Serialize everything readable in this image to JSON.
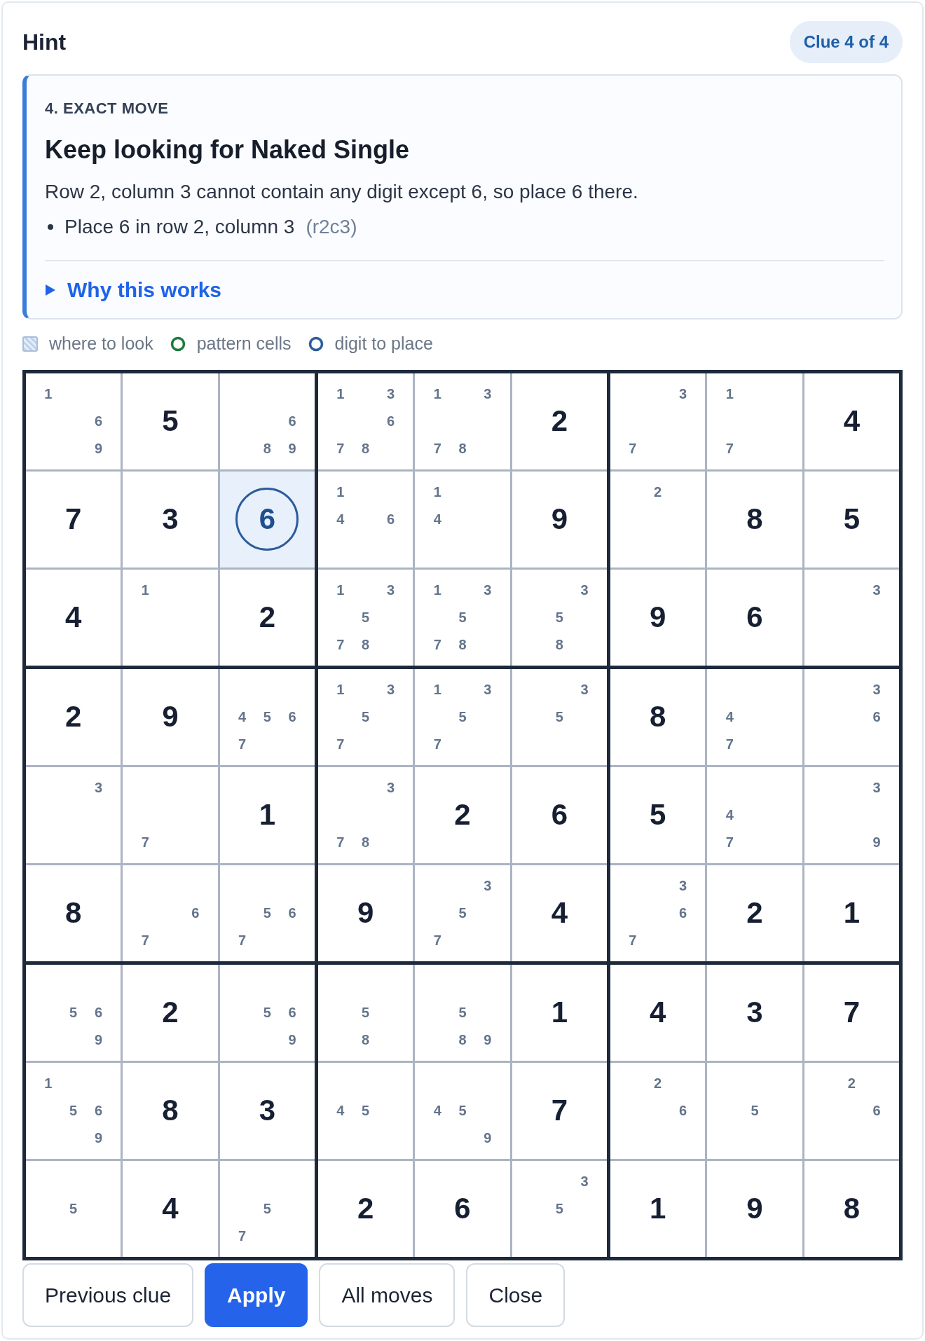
{
  "title": "Hint",
  "badge": "Clue 4 of 4",
  "hint": {
    "step": "4. EXACT MOVE",
    "heading": "Keep looking for Naked Single",
    "text": "Row 2, column 3 cannot contain any digit except 6, so place 6 there.",
    "bullets": [
      {
        "text": "Place 6 in row 2, column 3",
        "ref": "(r2c3)"
      }
    ],
    "details": {
      "label": "Why this works",
      "expanded": false
    }
  },
  "legend": [
    {
      "kind": "hatch",
      "label": "where to look"
    },
    {
      "kind": "ring",
      "label": "pattern cells",
      "color": "#1e7a3c"
    },
    {
      "kind": "ring",
      "label": "digit to place",
      "color": "#2c5c9c"
    }
  ],
  "grid": [
    [
      {
        "kind": "candidates",
        "candidates": [
          "1",
          "6",
          "9"
        ]
      },
      {
        "kind": "given",
        "value": "5"
      },
      {
        "kind": "candidates",
        "candidates": [
          "6",
          "8",
          "9"
        ]
      },
      {
        "kind": "candidates",
        "candidates": [
          "1",
          "3",
          "6",
          "7",
          "8"
        ]
      },
      {
        "kind": "candidates",
        "candidates": [
          "1",
          "3",
          "7",
          "8"
        ]
      },
      {
        "kind": "given",
        "value": "2"
      },
      {
        "kind": "candidates",
        "candidates": [
          "3",
          "7"
        ]
      },
      {
        "kind": "candidates",
        "candidates": [
          "1",
          "7"
        ]
      },
      {
        "kind": "given",
        "value": "4"
      }
    ],
    [
      {
        "kind": "given",
        "value": "7"
      },
      {
        "kind": "given",
        "value": "3"
      },
      {
        "kind": "place",
        "value": "6"
      },
      {
        "kind": "candidates",
        "candidates": [
          "1",
          "4",
          "6"
        ]
      },
      {
        "kind": "candidates",
        "candidates": [
          "1",
          "4"
        ]
      },
      {
        "kind": "given",
        "value": "9"
      },
      {
        "kind": "candidates",
        "candidates": [
          "2"
        ]
      },
      {
        "kind": "given",
        "value": "8"
      },
      {
        "kind": "given",
        "value": "5"
      }
    ],
    [
      {
        "kind": "given",
        "value": "4"
      },
      {
        "kind": "candidates",
        "candidates": [
          "1"
        ]
      },
      {
        "kind": "given",
        "value": "2"
      },
      {
        "kind": "candidates",
        "candidates": [
          "1",
          "3",
          "5",
          "7",
          "8"
        ]
      },
      {
        "kind": "candidates",
        "candidates": [
          "1",
          "3",
          "5",
          "7",
          "8"
        ]
      },
      {
        "kind": "candidates",
        "candidates": [
          "3",
          "5",
          "8"
        ]
      },
      {
        "kind": "given",
        "value": "9"
      },
      {
        "kind": "given",
        "value": "6"
      },
      {
        "kind": "candidates",
        "candidates": [
          "3"
        ]
      }
    ],
    [
      {
        "kind": "given",
        "value": "2"
      },
      {
        "kind": "given",
        "value": "9"
      },
      {
        "kind": "candidates",
        "candidates": [
          "4",
          "5",
          "6",
          "7"
        ]
      },
      {
        "kind": "candidates",
        "candidates": [
          "1",
          "3",
          "5",
          "7"
        ]
      },
      {
        "kind": "candidates",
        "candidates": [
          "1",
          "3",
          "5",
          "7"
        ]
      },
      {
        "kind": "candidates",
        "candidates": [
          "3",
          "5"
        ]
      },
      {
        "kind": "given",
        "value": "8"
      },
      {
        "kind": "candidates",
        "candidates": [
          "4",
          "7"
        ]
      },
      {
        "kind": "candidates",
        "candidates": [
          "3",
          "6"
        ]
      }
    ],
    [
      {
        "kind": "candidates",
        "candidates": [
          "3"
        ]
      },
      {
        "kind": "candidates",
        "candidates": [
          "7"
        ]
      },
      {
        "kind": "given",
        "value": "1"
      },
      {
        "kind": "candidates",
        "candidates": [
          "3",
          "7",
          "8"
        ]
      },
      {
        "kind": "given",
        "value": "2"
      },
      {
        "kind": "given",
        "value": "6"
      },
      {
        "kind": "given",
        "value": "5"
      },
      {
        "kind": "candidates",
        "candidates": [
          "4",
          "7"
        ]
      },
      {
        "kind": "candidates",
        "candidates": [
          "3",
          "9"
        ]
      }
    ],
    [
      {
        "kind": "given",
        "value": "8"
      },
      {
        "kind": "candidates",
        "candidates": [
          "6",
          "7"
        ]
      },
      {
        "kind": "candidates",
        "candidates": [
          "5",
          "6",
          "7"
        ]
      },
      {
        "kind": "given",
        "value": "9"
      },
      {
        "kind": "candidates",
        "candidates": [
          "3",
          "5",
          "7"
        ]
      },
      {
        "kind": "given",
        "value": "4"
      },
      {
        "kind": "candidates",
        "candidates": [
          "3",
          "6",
          "7"
        ]
      },
      {
        "kind": "given",
        "value": "2"
      },
      {
        "kind": "given",
        "value": "1"
      }
    ],
    [
      {
        "kind": "candidates",
        "candidates": [
          "5",
          "6",
          "9"
        ]
      },
      {
        "kind": "given",
        "value": "2"
      },
      {
        "kind": "candidates",
        "candidates": [
          "5",
          "6",
          "9"
        ]
      },
      {
        "kind": "candidates",
        "candidates": [
          "5",
          "8"
        ]
      },
      {
        "kind": "candidates",
        "candidates": [
          "5",
          "8",
          "9"
        ]
      },
      {
        "kind": "given",
        "value": "1"
      },
      {
        "kind": "given",
        "value": "4"
      },
      {
        "kind": "given",
        "value": "3"
      },
      {
        "kind": "given",
        "value": "7"
      }
    ],
    [
      {
        "kind": "candidates",
        "candidates": [
          "1",
          "5",
          "6",
          "9"
        ]
      },
      {
        "kind": "given",
        "value": "8"
      },
      {
        "kind": "given",
        "value": "3"
      },
      {
        "kind": "candidates",
        "candidates": [
          "4",
          "5"
        ]
      },
      {
        "kind": "candidates",
        "candidates": [
          "4",
          "5",
          "9"
        ]
      },
      {
        "kind": "given",
        "value": "7"
      },
      {
        "kind": "candidates",
        "candidates": [
          "2",
          "6"
        ]
      },
      {
        "kind": "candidates",
        "candidates": [
          "5"
        ]
      },
      {
        "kind": "candidates",
        "candidates": [
          "2",
          "6"
        ]
      }
    ],
    [
      {
        "kind": "candidates",
        "candidates": [
          "5"
        ]
      },
      {
        "kind": "given",
        "value": "4"
      },
      {
        "kind": "candidates",
        "candidates": [
          "5",
          "7"
        ]
      },
      {
        "kind": "given",
        "value": "2"
      },
      {
        "kind": "given",
        "value": "6"
      },
      {
        "kind": "candidates",
        "candidates": [
          "3",
          "5"
        ]
      },
      {
        "kind": "given",
        "value": "1"
      },
      {
        "kind": "given",
        "value": "9"
      },
      {
        "kind": "given",
        "value": "8"
      }
    ]
  ],
  "buttons": [
    {
      "label": "Previous clue",
      "primary": false
    },
    {
      "label": "Apply",
      "primary": true
    },
    {
      "label": "All moves",
      "primary": false
    },
    {
      "label": "Close",
      "primary": false
    }
  ]
}
